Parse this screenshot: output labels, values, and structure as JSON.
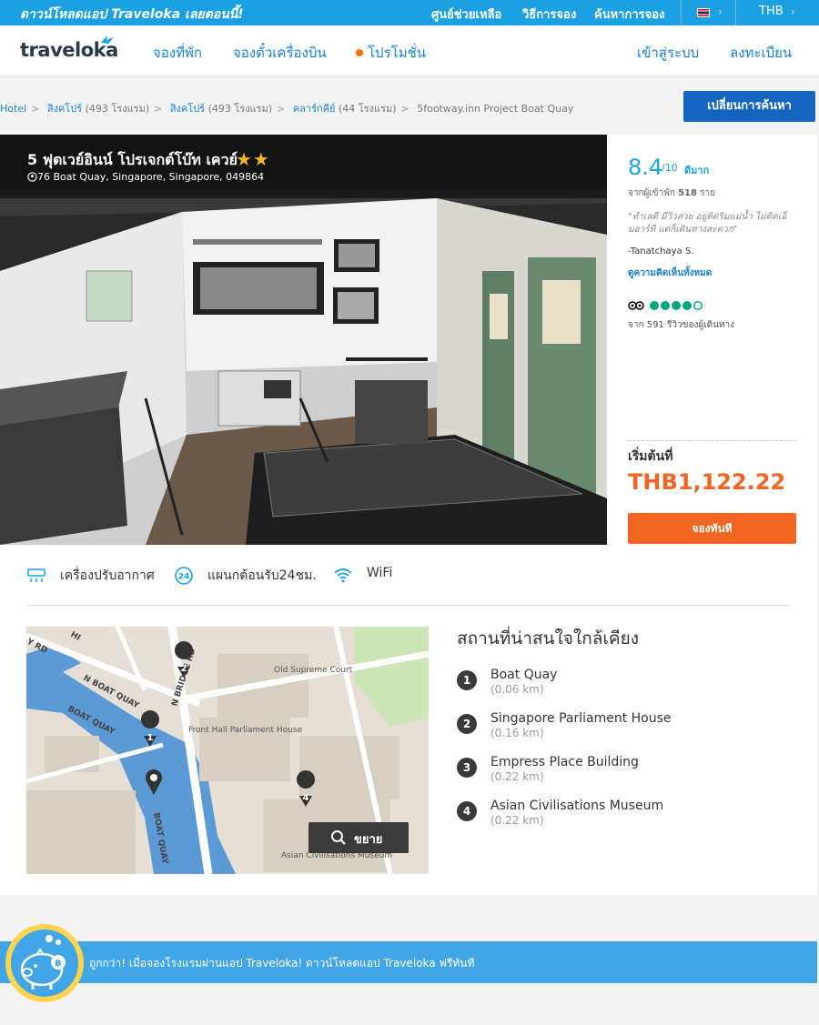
{
  "topbar": {
    "promo": "ดาวน์โหลดแอป Traveloka เลยตอนนี้!",
    "help": "ศูนย์ช่วยเหลือ",
    "how_to_book": "วิธีการจอง",
    "find_booking": "ค้นหาการจอง",
    "currency": "THB",
    "chevron": "›"
  },
  "nav": {
    "logo": "traveloka",
    "hotels": "จองที่พัก",
    "flights": "จองตั๋วเครื่องบิน",
    "promotions": "โปรโมชั่น",
    "login": "เข้าสู่ระบบ",
    "register": "ลงทะเบียน"
  },
  "breadcrumb": [
    {
      "link": "Hotel",
      "extra": ""
    },
    {
      "link": "สิงคโปร์",
      "extra": " (493 โรงแรม)"
    },
    {
      "link": "สิงคโปร์",
      "extra": " (493 โรงแรม)"
    },
    {
      "link": "คลาร์กคีย์",
      "extra": " (44 โรงแรม)"
    }
  ],
  "breadcrumb_current": "5footway.inn Project Boat Quay",
  "breadcrumb_sep": ">",
  "change_search": "เปลี่ยนการค้นหา",
  "hotel": {
    "name": "5 ฟุตเวย์อินน์ โปรเจกต์โบ๊ท เควย์",
    "stars": "★★",
    "address": "76 Boat Quay, Singapore, Singapore, 049864",
    "star_rating": 2
  },
  "review": {
    "score": "8.4",
    "out_of": "/10",
    "word": "ดีมาก",
    "from_prefix": "จากผู้เข้าพัก",
    "count": "518",
    "count_suffix": "ราย",
    "quote": "\"ทำเลดี มีวิวสวย อยู่ติดริมแม่น้ำ ไม่ติดเอ็มอาร์ที แต่ก็เดินทางสะดวก\"",
    "author": "-Tanatchaya S.",
    "all_reviews": "ดูความคิดเห็นทั้งหมด",
    "ta_bubbles": 4,
    "ta_prefix": "จาก",
    "ta_count": "591",
    "ta_suffix": "รีวิวของผู้เดินทาง"
  },
  "pricing": {
    "start_from": "เริ่มต้นที่",
    "price": "THB1,122.22",
    "book_now": "จองทันที"
  },
  "amenities": [
    {
      "icon": "air-conditioner-icon",
      "label": "เครื่องปรับอากาศ"
    },
    {
      "icon": "24-hour-icon",
      "label": "แผนกต้อนรับ24ชม."
    },
    {
      "icon": "wifi-icon",
      "label": "WiFi"
    }
  ],
  "map": {
    "enlarge": "ขยาย",
    "labels": [
      "N BOAT QUAY",
      "BOAT QUAY",
      "N BRIDGE RD",
      "Old Supreme Court",
      "Front Hall Parliament House",
      "BOAT QUAY",
      "Asian Civilisations Museum",
      "HI",
      "Y RD"
    ]
  },
  "nearby": {
    "title": "สถานที่น่าสนใจใกล้เคียง",
    "items": [
      {
        "num": "1",
        "name": "Boat Quay",
        "dist": "(0.06 km)"
      },
      {
        "num": "2",
        "name": "Singapore Parliament House",
        "dist": "(0.16 km)"
      },
      {
        "num": "3",
        "name": "Empress Place Building",
        "dist": "(0.22 km)"
      },
      {
        "num": "4",
        "name": "Asian Civilisations Museum",
        "dist": "(0.22 km)"
      }
    ]
  },
  "banner": {
    "text": "ถูกกว่า! เมื่อจองโรงแรมผ่านแอป Traveloka! ดาวน์โหลดแอป Traveloka ฟรีทันที"
  },
  "colors": {
    "brand_blue": "#1ba0e2",
    "link_blue": "#1a7fd4",
    "price_orange": "#f26522",
    "button_blue": "#1565c0"
  }
}
